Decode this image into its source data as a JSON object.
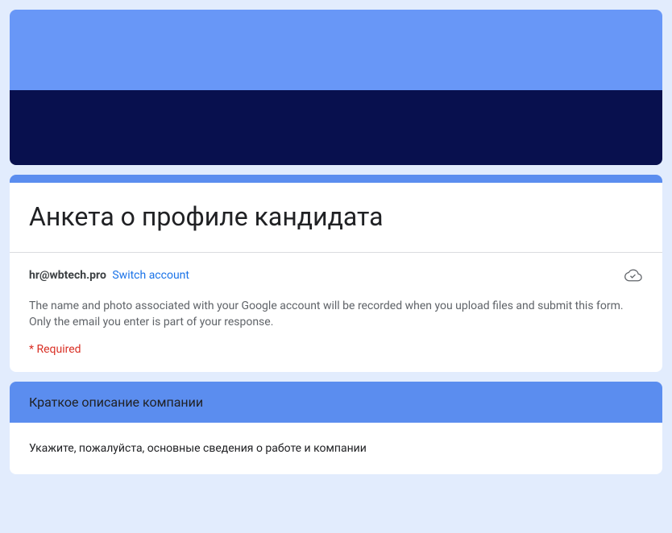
{
  "form": {
    "title": "Анкета о профиле кандидата",
    "account_email": "hr@wbtech.pro",
    "switch_account_label": "Switch account",
    "description": "The name and photo associated with your Google account will be recorded when you upload files and submit this form. Only the email you enter is part of your response.",
    "required_label": "* Required"
  },
  "section": {
    "title": "Краткое описание компании",
    "body": "Укажите, пожалуйста, основные сведения о работе и компании"
  }
}
